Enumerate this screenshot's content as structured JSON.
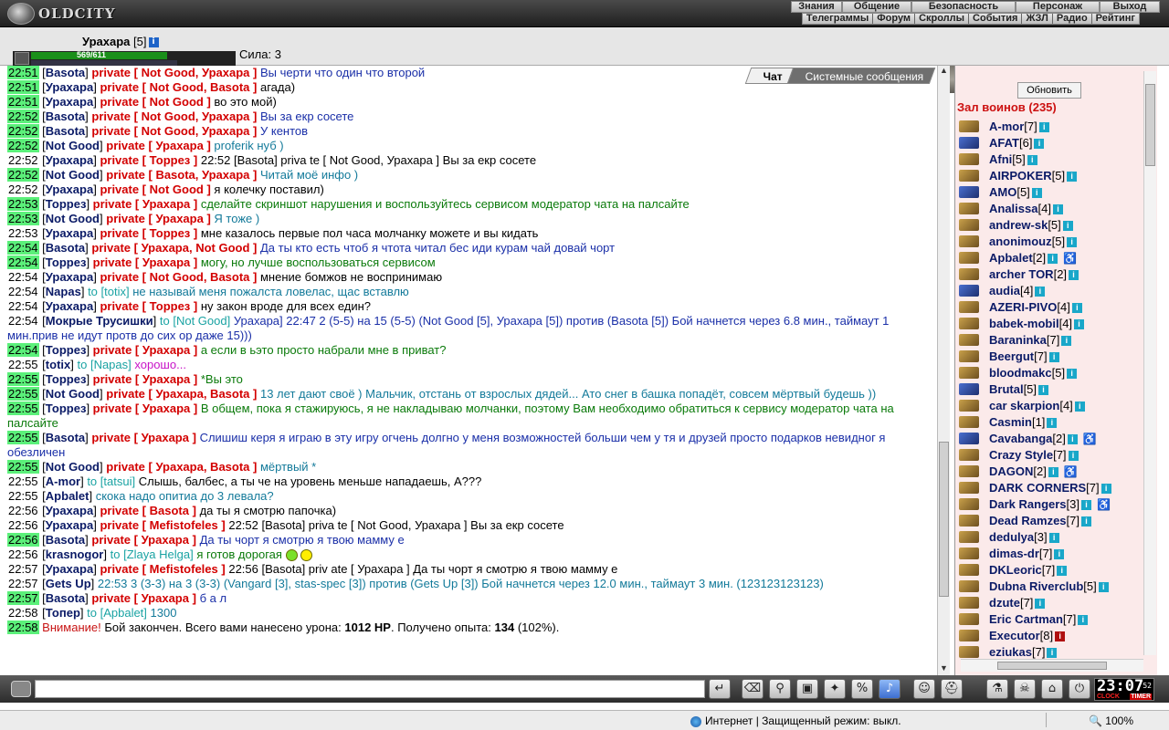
{
  "app": {
    "logo_text": "OLDCITY"
  },
  "menu_top": [
    "Знания",
    "Общение",
    "Безопасность",
    "Персонаж",
    "Выход"
  ],
  "menu_sub": [
    "Телеграммы",
    "Форум",
    "Скроллы",
    "События",
    "ЖЗЛ",
    "Радио",
    "Рейтинг"
  ],
  "player": {
    "name": "Урахара",
    "level": "[5]",
    "hp": "569/611",
    "hp_fraction": 0.93,
    "strength": "Сила: 3"
  },
  "chat": {
    "tabs": [
      "Чат",
      "Системные сообщения"
    ],
    "active_tab": "Чат",
    "lines": [
      {
        "t": "22:51",
        "hl": true,
        "n": "Basota",
        "p": "Not Good, Урахара",
        "m": "Вы черти что один что второй",
        "c": "m-blue"
      },
      {
        "t": "22:51",
        "hl": true,
        "n": "Урахара",
        "p": "Not Good, Basota",
        "m": "агада)",
        "c": "m-black"
      },
      {
        "t": "22:51",
        "hl": true,
        "n": "Урахара",
        "p": "Not Good",
        "m": "во это мой)",
        "c": "m-black"
      },
      {
        "t": "22:52",
        "hl": true,
        "n": "Basota",
        "p": "Not Good, Урахара",
        "m": "Вы за екр сосете",
        "c": "m-blue"
      },
      {
        "t": "22:52",
        "hl": true,
        "n": "Basota",
        "p": "Not Good, Урахара",
        "m": "У кентов",
        "c": "m-blue"
      },
      {
        "t": "22:52",
        "hl": true,
        "n": "Not Good",
        "p": "Урахара",
        "m": "proferik нуб )",
        "c": "m-teal"
      },
      {
        "t": "22:52",
        "hl": false,
        "n": "Урахара",
        "p": "Торрез",
        "m": "22:52 [Basota] priva te [ Not Good, Урахара ] Вы за екр сосете",
        "c": "m-black"
      },
      {
        "t": "22:52",
        "hl": true,
        "n": "Not Good",
        "p": "Basota, Урахара",
        "m": "Читай моё инфо )",
        "c": "m-teal"
      },
      {
        "t": "22:52",
        "hl": false,
        "n": "Урахара",
        "p": "Not Good",
        "m": "я колечку поставил)",
        "c": "m-black"
      },
      {
        "t": "22:53",
        "hl": true,
        "n": "Торрез",
        "p": "Урахара",
        "m": "сделайте скриншот нарушения и воспользуйтесь сервисом модератор чата на палсайте",
        "c": "m-green"
      },
      {
        "t": "22:53",
        "hl": true,
        "n": "Not Good",
        "p": "Урахара",
        "m": "Я тоже )",
        "c": "m-teal"
      },
      {
        "t": "22:53",
        "hl": false,
        "n": "Урахара",
        "p": "Торрез",
        "m": "мне казалось первые пол часа молчанку можете и вы кидать",
        "c": "m-black"
      },
      {
        "t": "22:54",
        "hl": true,
        "n": "Basota",
        "p": "Урахара, Not Good",
        "m": "Да ты кто есть чтоб я чтота читал бес иди курам чай довай чорт",
        "c": "m-blue"
      },
      {
        "t": "22:54",
        "hl": true,
        "n": "Торрез",
        "p": "Урахара",
        "m": "могу, но лучше воспользоваться сервисом",
        "c": "m-green"
      },
      {
        "t": "22:54",
        "hl": false,
        "n": "Урахара",
        "p": "Not Good, Basota",
        "m": "мнение бомжов не воспринимаю",
        "c": "m-black"
      },
      {
        "t": "22:54",
        "hl": false,
        "n": "Napas",
        "to": "totix",
        "m": "не называй меня пожалста ловелас, щас вставлю",
        "c": "m-teal"
      },
      {
        "t": "22:54",
        "hl": false,
        "n": "Урахара",
        "p": "Торрез",
        "m": "ну закон вроде для всех един?",
        "c": "m-black"
      },
      {
        "t": "22:54",
        "hl": false,
        "n": "Мокрые Трусишки",
        "to": "Not Good",
        "m": "Урахара] 22:47 2 (5-5) на 15 (5-5) (Not Good [5], Урахара [5]) против (Basota [5]) Бой начнется через 6.8 мин., таймаут 1 мин.прив не идут протв до сих ор даже 15)))",
        "c": "m-blue"
      },
      {
        "t": "22:54",
        "hl": true,
        "n": "Торрез",
        "p": "Урахара",
        "m": "а если в ьэто просто набрали мне в приват?",
        "c": "m-green"
      },
      {
        "t": "22:55",
        "hl": false,
        "n": "totix",
        "to": "Napas",
        "m": "хорошо...",
        "c": "m-magenta"
      },
      {
        "t": "22:55",
        "hl": true,
        "n": "Торрез",
        "p": "Урахара",
        "m": "*Вы это",
        "c": "m-green"
      },
      {
        "t": "22:55",
        "hl": true,
        "n": "Not Good",
        "p": "Урахара, Basota",
        "m": "13 лет дают своё ) Мальчик, отстань от взрослых дядей... Ато снег в башка попадёт, совсем мёртвый будешь ))",
        "c": "m-teal"
      },
      {
        "t": "22:55",
        "hl": true,
        "n": "Торрез",
        "p": "Урахара",
        "m": "В общем, пока я стажируюсь, я не накладываю молчанки, поэтому Вам необходимо обратиться к сервису модератор чата на палсайте",
        "c": "m-green"
      },
      {
        "t": "22:55",
        "hl": true,
        "n": "Basota",
        "p": "Урахара",
        "m": "Слишиш керя я играю в эту игру огчень долгно у меня возможностей больши чем у тя и друзей просто подарков невидног я обезличен",
        "c": "m-blue"
      },
      {
        "t": "22:55",
        "hl": true,
        "n": "Not Good",
        "p": "Урахара, Basota",
        "m": "мёртвый *",
        "c": "m-teal"
      },
      {
        "t": "22:55",
        "hl": false,
        "n": "A-mor",
        "to": "tatsui",
        "m": "Слышь, балбес, а ты че на уровень меньше нападаешь, А???",
        "c": "m-black"
      },
      {
        "t": "22:55",
        "hl": false,
        "n": "Apbalet",
        "m": "скока надо опитиа до 3 левала?",
        "c": "m-teal"
      },
      {
        "t": "22:56",
        "hl": false,
        "n": "Урахара",
        "p": "Basota",
        "m": "да ты я смотрю папочка)",
        "c": "m-black"
      },
      {
        "t": "22:56",
        "hl": false,
        "n": "Урахара",
        "p": "Mefistofeles",
        "m": "22:52 [Basota] priva te [ Not Good, Урахара ] Вы за екр сосете",
        "c": "m-black"
      },
      {
        "t": "22:56",
        "hl": true,
        "n": "Basota",
        "p": "Урахара",
        "m": "Да ты чорт я смотрю я твою мамму е",
        "c": "m-blue"
      },
      {
        "t": "22:56",
        "hl": false,
        "n": "krasnogor",
        "to": "Zlaya Helga",
        "m": "я готов дорогая",
        "c": "m-green",
        "smiley": true
      },
      {
        "t": "22:57",
        "hl": false,
        "n": "Урахара",
        "p": "Mefistofeles",
        "m": "22:56 [Basota] priv ate [ Урахара ] Да ты чорт я смотрю я твою мамму е",
        "c": "m-black"
      },
      {
        "t": "22:57",
        "hl": false,
        "n": "Gets Up",
        "m": "22:53 3 (3-3) на 3 (3-3) (Vangard [3], stas-spec [3]) против (Gets Up [3]) Бой начнется через 12.0 мин., таймаут 3 мин. (123123123123)",
        "c": "m-teal"
      },
      {
        "t": "22:57",
        "hl": true,
        "n": "Basota",
        "p": "Урахара",
        "m": "б а л",
        "c": "m-blue"
      },
      {
        "t": "22:58",
        "hl": false,
        "n": "Топер",
        "to": "Apbalet",
        "m": "1300",
        "c": "m-teal"
      }
    ],
    "system": {
      "t": "22:58",
      "label": "Внимание!",
      "pre": "Бой закончен. Всего вами нанесено урона:",
      "dmg": "1012 HP",
      "mid": ". Получено опыта:",
      "exp": "134",
      "post": "(102%)."
    }
  },
  "sidebar": {
    "refresh_label": "Обновить",
    "hall_title": "Зал воинов (235)",
    "players": [
      {
        "n": "A-mor",
        "l": "[7]",
        "b": "i"
      },
      {
        "n": "AFAT",
        "l": "[6]",
        "b": "i",
        "ico": "blue"
      },
      {
        "n": "Afni",
        "l": "[5]",
        "b": "i"
      },
      {
        "n": "AIRPOKER",
        "l": "[5]",
        "b": "i"
      },
      {
        "n": "AMO",
        "l": "[5]",
        "b": "i",
        "ico": "blue"
      },
      {
        "n": "Analissa",
        "l": "[4]",
        "b": "i"
      },
      {
        "n": "andrew-sk",
        "l": "[5]",
        "b": "i"
      },
      {
        "n": "anonimouz",
        "l": "[5]",
        "b": "i"
      },
      {
        "n": "Apbalet",
        "l": "[2]",
        "b": "i",
        "mod": true
      },
      {
        "n": "archer TOR",
        "l": "[2]",
        "b": "i"
      },
      {
        "n": "audia",
        "l": "[4]",
        "b": "i",
        "ico": "blue"
      },
      {
        "n": "AZERI-PIVO",
        "l": "[4]",
        "b": "i"
      },
      {
        "n": "babek-mobil",
        "l": "[4]",
        "b": "i"
      },
      {
        "n": "Baraninka",
        "l": "[7]",
        "b": "i"
      },
      {
        "n": "Beergut",
        "l": "[7]",
        "b": "i"
      },
      {
        "n": "bloodmakc",
        "l": "[5]",
        "b": "i"
      },
      {
        "n": "Brutal",
        "l": "[5]",
        "b": "i",
        "ico": "blue"
      },
      {
        "n": "car skarpion",
        "l": "[4]",
        "b": "i"
      },
      {
        "n": "Casmin",
        "l": "[1]",
        "b": "i"
      },
      {
        "n": "Cavabanga",
        "l": "[2]",
        "b": "i",
        "mod": true,
        "ico": "blue"
      },
      {
        "n": "Crazy Style",
        "l": "[7]",
        "b": "i"
      },
      {
        "n": "DAGON",
        "l": "[2]",
        "b": "i",
        "mod": true
      },
      {
        "n": "DARK CORNERS",
        "l": "[7]",
        "b": "i"
      },
      {
        "n": "Dark Rangers",
        "l": "[3]",
        "b": "i",
        "mod": true
      },
      {
        "n": "Dead Ramzes",
        "l": "[7]",
        "b": "i"
      },
      {
        "n": "dedulya",
        "l": "[3]",
        "b": "i"
      },
      {
        "n": "dimas-dr",
        "l": "[7]",
        "b": "i"
      },
      {
        "n": "DKLeoric",
        "l": "[7]",
        "b": "i"
      },
      {
        "n": "Dubna Riverclub",
        "l": "[5]",
        "b": "i"
      },
      {
        "n": "dzute",
        "l": "[7]",
        "b": "i"
      },
      {
        "n": "Eric Cartman",
        "l": "[7]",
        "b": "i"
      },
      {
        "n": "Executor",
        "l": "[8]",
        "b": "i",
        "red": true
      },
      {
        "n": "eziukas",
        "l": "[7]",
        "b": "i"
      }
    ]
  },
  "bottom": {
    "clock": "23:07",
    "clock_sec": "52",
    "clock_label": "CLOCK",
    "timer_label": "TIMER"
  },
  "statusbar": {
    "zone": "Интернет | Защищенный режим: выкл.",
    "zoom": "100%"
  }
}
